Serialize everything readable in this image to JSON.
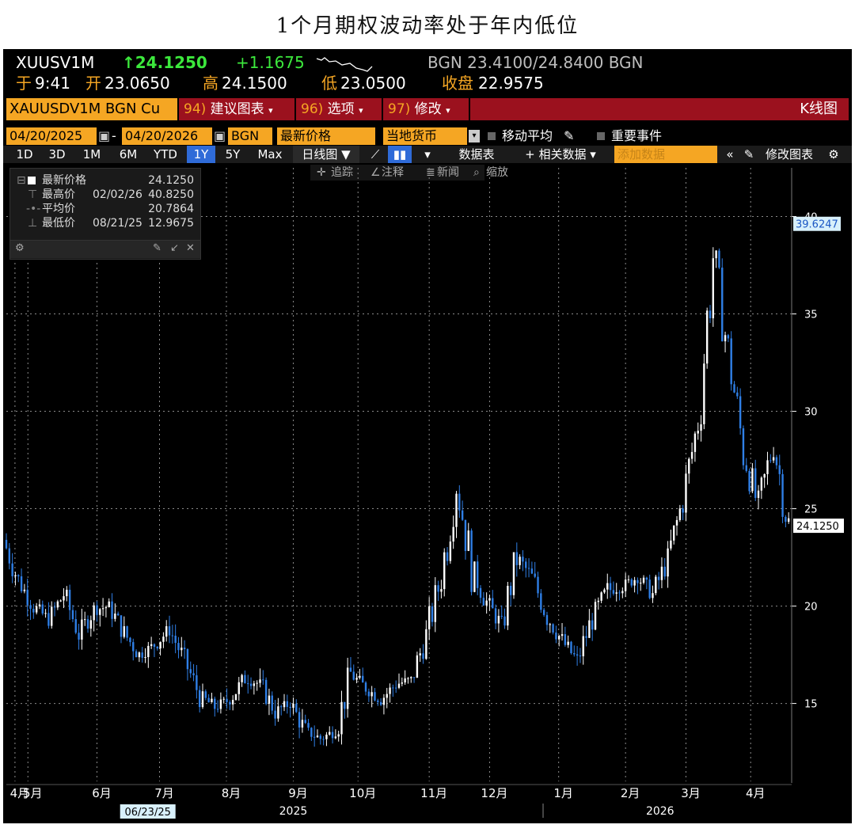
{
  "page_title": "1个月期权波动率处于年内低位",
  "header": {
    "ticker": "XUUSV1M",
    "last": "↑24.1250",
    "change": "+1.1675",
    "bid_ask": "BGN 23.4100/24.8400 BGN",
    "time_prefix": "于",
    "time": "9:41",
    "open_label": "开",
    "open": "23.0650",
    "high_label": "高",
    "high": "24.1500",
    "low_label": "低",
    "low": "23.0500",
    "close_label": "收盘",
    "close": "22.9575"
  },
  "command_bar": {
    "security": "XAUUSDV1M BGN Cu",
    "menu1_num": "94)",
    "menu1": "建议图表",
    "menu2_num": "96)",
    "menu2": "选项",
    "menu3_num": "97)",
    "menu3": "修改",
    "chart_type": "K线图"
  },
  "settings": {
    "start_date": "04/20/2025",
    "end_date": "04/20/2026",
    "source": "BGN",
    "field": "最新价格",
    "currency": "当地货币",
    "moving_avg": "移动平均",
    "events": "重要事件"
  },
  "toolbar": {
    "ranges": [
      "1D",
      "3D",
      "1M",
      "6M",
      "YTD",
      "1Y",
      "5Y",
      "Max"
    ],
    "active_range": "1Y",
    "period": "日线图 ▼",
    "table": "数据表",
    "related": "+ 相关数据 ▾",
    "add_data": "添加数据",
    "edit_chart": "修改图表"
  },
  "tools": {
    "track": "追踪",
    "annotate": "注释",
    "news": "新闻",
    "zoom": "缩放"
  },
  "legend": {
    "rows": [
      {
        "label": "最新价格",
        "date": "",
        "value": "24.1250"
      },
      {
        "label": "最高价",
        "date": "02/02/26",
        "value": "40.8250"
      },
      {
        "label": "平均价",
        "date": "",
        "value": "20.7864"
      },
      {
        "label": "最低价",
        "date": "08/21/25",
        "value": "12.9675"
      }
    ]
  },
  "colors": {
    "up": "#ffffff",
    "down": "#2f7fe6",
    "grid": "#8a8a8a",
    "orange": "#f5a623",
    "title_bar": "#9b111e"
  },
  "chart_data": {
    "type": "candlestick",
    "title": "",
    "ylim": [
      11,
      42.5
    ],
    "y_ticks": [
      15,
      20,
      25,
      30,
      35,
      40
    ],
    "tags": {
      "high_tag": "39.6247",
      "last_tag": "24.1250"
    },
    "x_ticks": [
      {
        "label": "4月",
        "date": "2025-04-25"
      },
      {
        "label": "5月",
        "date": "2025-05-01"
      },
      {
        "label": "6月",
        "date": "2025-06-02"
      },
      {
        "label": "7月",
        "date": "2025-07-01"
      },
      {
        "label": "8月",
        "date": "2025-08-01"
      },
      {
        "label": "9月",
        "date": "2025-09-01"
      },
      {
        "label": "10月",
        "date": "2025-10-01"
      },
      {
        "label": "11月",
        "date": "2025-11-03"
      },
      {
        "label": "12月",
        "date": "2025-12-01"
      },
      {
        "label": "1月",
        "date": "2026-01-02"
      },
      {
        "label": "2月",
        "date": "2026-02-02"
      },
      {
        "label": "3月",
        "date": "2026-03-02"
      },
      {
        "label": "4月",
        "date": "2026-04-01"
      }
    ],
    "year_labels": [
      {
        "label": "2025",
        "date": "2025-09-01"
      },
      {
        "label": "2026",
        "date": "2026-02-18"
      }
    ],
    "date_tag": {
      "label": "06/23/25",
      "date": "2025-06-23"
    },
    "x_range": [
      "2025-04-21",
      "2026-04-20"
    ],
    "series": [
      {
        "date": "2025-04-21",
        "close": 23.4
      },
      {
        "date": "2025-04-28",
        "close": 21.3
      },
      {
        "date": "2025-05-05",
        "close": 20.0
      },
      {
        "date": "2025-05-12",
        "close": 19.3
      },
      {
        "date": "2025-05-19",
        "close": 20.6
      },
      {
        "date": "2025-05-26",
        "close": 18.6
      },
      {
        "date": "2025-06-02",
        "close": 19.8
      },
      {
        "date": "2025-06-09",
        "close": 20.0
      },
      {
        "date": "2025-06-16",
        "close": 18.6
      },
      {
        "date": "2025-06-23",
        "close": 17.5
      },
      {
        "date": "2025-06-30",
        "close": 18.0
      },
      {
        "date": "2025-07-07",
        "close": 18.8
      },
      {
        "date": "2025-07-14",
        "close": 17.2
      },
      {
        "date": "2025-07-21",
        "close": 15.4
      },
      {
        "date": "2025-07-28",
        "close": 14.8
      },
      {
        "date": "2025-08-04",
        "close": 15.2
      },
      {
        "date": "2025-08-11",
        "close": 16.3
      },
      {
        "date": "2025-08-18",
        "close": 16.0
      },
      {
        "date": "2025-08-25",
        "close": 14.6
      },
      {
        "date": "2025-09-01",
        "close": 15.0
      },
      {
        "date": "2025-09-08",
        "close": 13.6
      },
      {
        "date": "2025-09-15",
        "close": 13.2
      },
      {
        "date": "2025-09-22",
        "close": 13.6
      },
      {
        "date": "2025-09-29",
        "close": 16.5
      },
      {
        "date": "2025-10-06",
        "close": 15.8
      },
      {
        "date": "2025-10-13",
        "close": 15.2
      },
      {
        "date": "2025-10-20",
        "close": 16.0
      },
      {
        "date": "2025-10-27",
        "close": 16.2
      },
      {
        "date": "2025-11-03",
        "close": 18.5
      },
      {
        "date": "2025-11-10",
        "close": 21.5
      },
      {
        "date": "2025-11-17",
        "close": 26.5
      },
      {
        "date": "2025-11-24",
        "close": 22.0
      },
      {
        "date": "2025-12-01",
        "close": 20.2
      },
      {
        "date": "2025-12-08",
        "close": 19.0
      },
      {
        "date": "2025-12-15",
        "close": 22.5
      },
      {
        "date": "2025-12-22",
        "close": 21.5
      },
      {
        "date": "2025-12-29",
        "close": 19.5
      },
      {
        "date": "2026-01-05",
        "close": 18.2
      },
      {
        "date": "2026-01-12",
        "close": 17.2
      },
      {
        "date": "2026-01-19",
        "close": 19.4
      },
      {
        "date": "2026-01-26",
        "close": 20.8
      },
      {
        "date": "2026-02-02",
        "close": 21.0
      },
      {
        "date": "2026-02-09",
        "close": 21.5
      },
      {
        "date": "2026-02-16",
        "close": 20.6
      },
      {
        "date": "2026-02-23",
        "close": 22.4
      },
      {
        "date": "2026-03-02",
        "close": 25.5
      },
      {
        "date": "2026-03-09",
        "close": 29.5
      },
      {
        "date": "2026-03-16",
        "close": 38.0
      },
      {
        "date": "2026-03-23",
        "close": 33.0
      },
      {
        "date": "2026-03-30",
        "close": 28.0
      },
      {
        "date": "2026-04-06",
        "close": 25.0
      },
      {
        "date": "2026-04-13",
        "close": 28.5
      },
      {
        "date": "2026-04-20",
        "close": 24.1
      }
    ]
  }
}
